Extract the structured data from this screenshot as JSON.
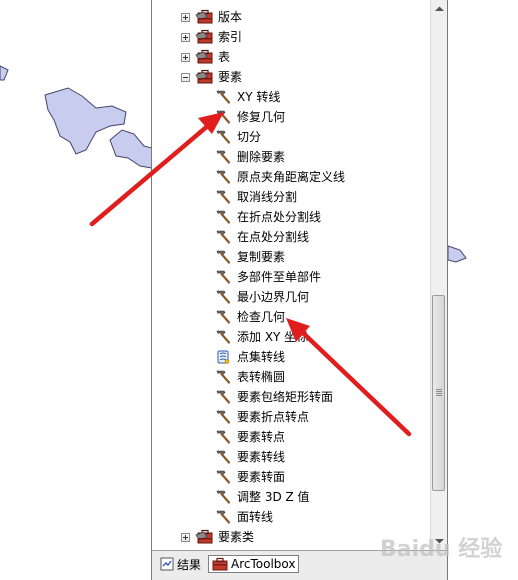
{
  "tree": {
    "toolsets_top": [
      {
        "label": "版本",
        "expanded": false
      },
      {
        "label": "索引",
        "expanded": false
      },
      {
        "label": "表",
        "expanded": false
      },
      {
        "label": "要素",
        "expanded": true
      }
    ],
    "tools": [
      {
        "label": "XY 转线",
        "icon": "hammer-icon"
      },
      {
        "label": "修复几何",
        "icon": "hammer-icon"
      },
      {
        "label": "切分",
        "icon": "hammer-icon"
      },
      {
        "label": "删除要素",
        "icon": "hammer-icon"
      },
      {
        "label": "原点夹角距离定义线",
        "icon": "hammer-icon"
      },
      {
        "label": "取消线分割",
        "icon": "hammer-icon"
      },
      {
        "label": "在折点处分割线",
        "icon": "hammer-icon"
      },
      {
        "label": "在点处分割线",
        "icon": "hammer-icon"
      },
      {
        "label": "复制要素",
        "icon": "hammer-icon"
      },
      {
        "label": "多部件至单部件",
        "icon": "hammer-icon"
      },
      {
        "label": "最小边界几何",
        "icon": "hammer-icon"
      },
      {
        "label": "检查几何",
        "icon": "hammer-icon"
      },
      {
        "label": "添加 XY 坐标",
        "icon": "hammer-icon"
      },
      {
        "label": "点集转线",
        "icon": "script-icon"
      },
      {
        "label": "表转椭圆",
        "icon": "hammer-icon"
      },
      {
        "label": "要素包络矩形转面",
        "icon": "hammer-icon"
      },
      {
        "label": "要素折点转点",
        "icon": "hammer-icon"
      },
      {
        "label": "要素转点",
        "icon": "hammer-icon"
      },
      {
        "label": "要素转线",
        "icon": "hammer-icon"
      },
      {
        "label": "要素转面",
        "icon": "hammer-icon"
      },
      {
        "label": "调整 3D Z 值",
        "icon": "hammer-icon"
      },
      {
        "label": "面转线",
        "icon": "hammer-icon"
      }
    ],
    "toolsets_bottom": [
      {
        "label": "要素类",
        "expanded": false
      }
    ]
  },
  "tabs": [
    {
      "label": "结果",
      "active": false
    },
    {
      "label": "ArcToolbox",
      "active": true
    }
  ],
  "colors": {
    "map_land": "#c8cdf0",
    "arrow": "#e01e1e",
    "toolbox_red": "#c0392b"
  },
  "icons": {
    "toolset": "toolbox-icon",
    "tool": "hammer-icon",
    "script": "script-icon"
  },
  "watermark": "Baidu 经验"
}
